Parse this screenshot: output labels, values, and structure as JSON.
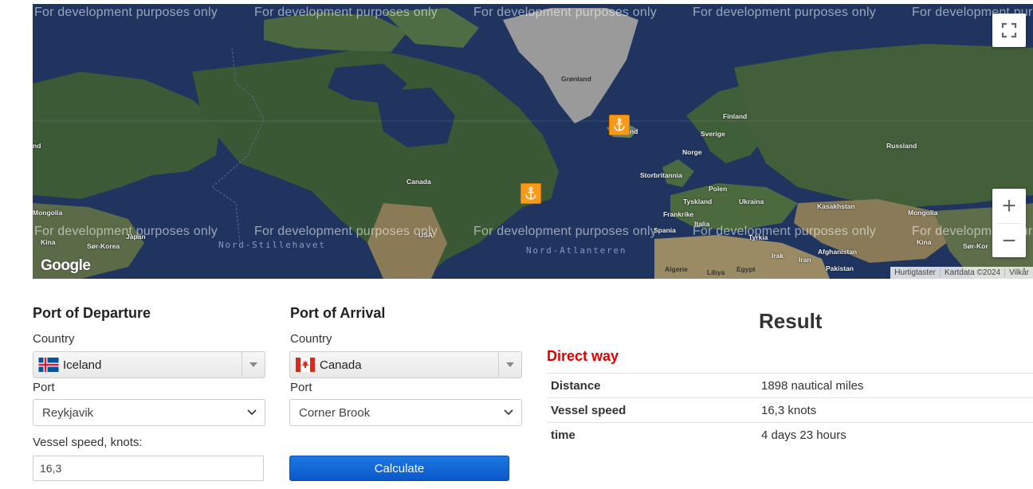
{
  "map": {
    "watermark": "For development purposes only",
    "labels": {
      "gronland": "Grønland",
      "canada": "Canada",
      "finland": "Finland",
      "sverige": "Sverige",
      "norge": "Norge",
      "storbritannia": "Storbritannia",
      "polen": "Polen",
      "tyskland": "Tyskland",
      "ukraina": "Ukraina",
      "frankrike": "Frankrike",
      "italia": "Italia",
      "spania": "Spania",
      "tyrkia": "Tyrkia",
      "russland": "Russland",
      "kasakhstan": "Kasakhstan",
      "mongolia_left": "Mongolia",
      "mongolia_right": "Mongolia",
      "kina_left": "Kina",
      "kina_right": "Kina",
      "japan": "Japan",
      "sor_korea_left": "Sør-Korea",
      "sor_korea_right": "Sør-Kor",
      "usa": "USA",
      "algerie": "Algerie",
      "libya": "Libya",
      "egypt": "Egypt",
      "irak": "Irak",
      "iran": "Iran",
      "afghanistan": "Afghanistan",
      "pakistan": "Pakistan",
      "island_fragment": "nd",
      "left_fragment": "nd"
    },
    "oceans": {
      "pacific": "Nord-Stillehavet",
      "atlantic": "Nord-Atlanteren"
    },
    "google_logo": "Google",
    "attribution": [
      "Hurtigtaster",
      "Kartdata ©2024",
      "Vilkår"
    ],
    "fullscreen_icon": "fullscreen-icon",
    "zoom_in": "+",
    "zoom_out": "−",
    "marker_icon": "anchor-icon",
    "marker_color": "#f79a1a"
  },
  "departure": {
    "heading": "Port of Departure",
    "country_label": "Country",
    "country": "Iceland",
    "port_label": "Port",
    "port": "Reykjavik",
    "speed_label": "Vessel speed, knots:",
    "speed_value": "16,3"
  },
  "arrival": {
    "heading": "Port of Arrival",
    "country_label": "Country",
    "country": "Canada",
    "port_label": "Port",
    "port": "Corner Brook"
  },
  "calculate_label": "Calculate",
  "result": {
    "title": "Result",
    "direct_way": "Direct way",
    "rows": [
      {
        "key": "Distance",
        "value": "1898 nautical miles"
      },
      {
        "key": "Vessel speed",
        "value": "16,3 knots"
      },
      {
        "key": "time",
        "value": "4 days 23 hours"
      }
    ]
  },
  "colors": {
    "direct_way": "#e00000",
    "button": "#0a58c8"
  }
}
